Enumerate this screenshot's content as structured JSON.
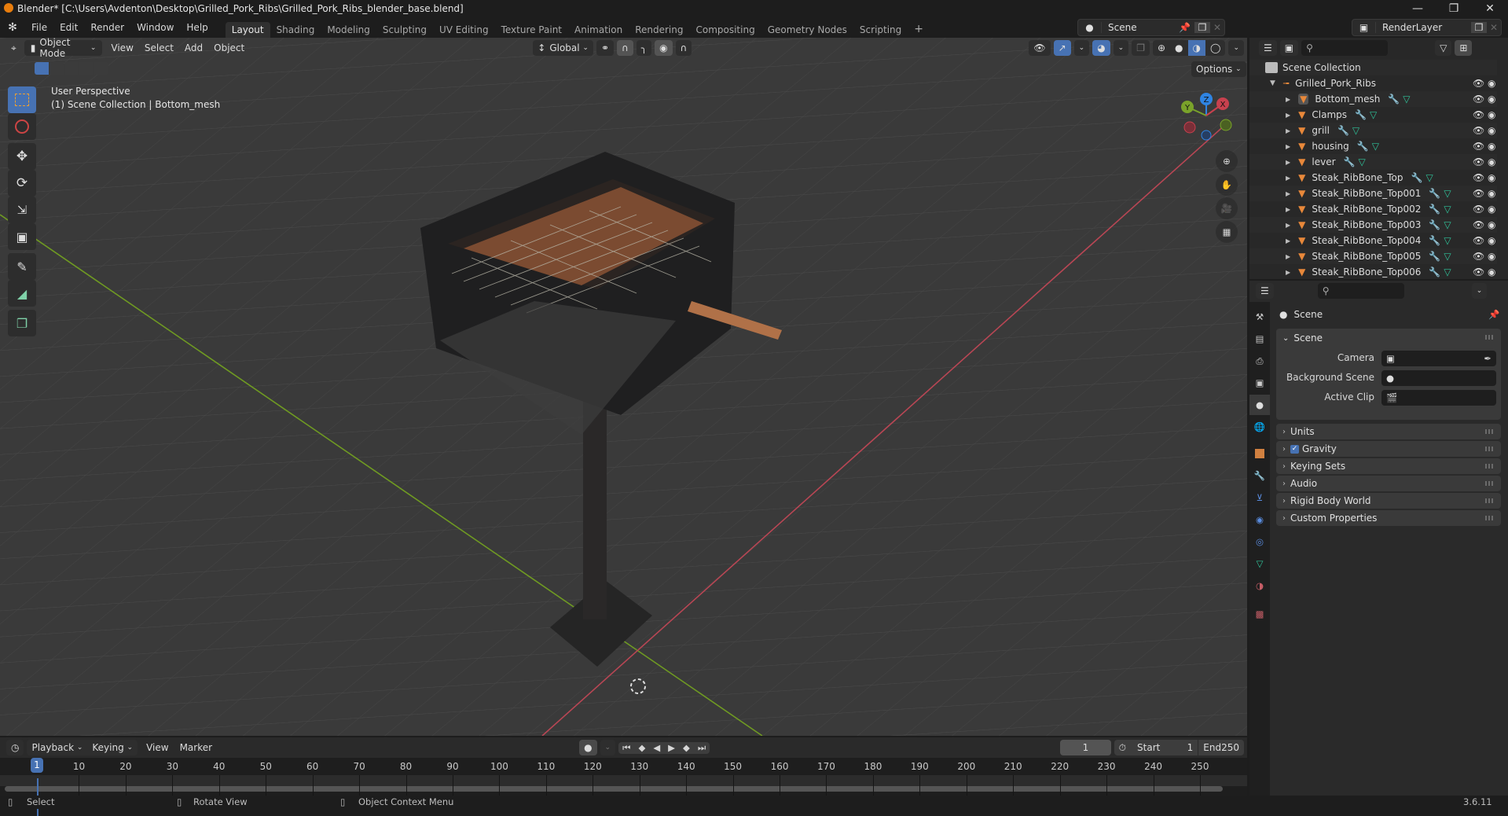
{
  "window": {
    "title": "Blender* [C:\\Users\\Avdenton\\Desktop\\Grilled_Pork_Ribs\\Grilled_Pork_Ribs_blender_base.blend]",
    "controls": [
      "minimize",
      "maximize",
      "close"
    ]
  },
  "menubar": {
    "items": [
      "File",
      "Edit",
      "Render",
      "Window",
      "Help"
    ],
    "workspaces": [
      "Layout",
      "Shading",
      "Modeling",
      "Sculpting",
      "UV Editing",
      "Texture Paint",
      "Animation",
      "Rendering",
      "Compositing",
      "Geometry Nodes",
      "Scripting"
    ],
    "active_workspace": "Layout",
    "add_workspace": "+",
    "scene": "Scene",
    "view_layer": "RenderLayer"
  },
  "viewport": {
    "mode": "Object Mode",
    "menus": [
      "View",
      "Select",
      "Add",
      "Object"
    ],
    "orientation": "Global",
    "options_label": "Options",
    "overlay_text": {
      "line1": "User Perspective",
      "line2": "(1) Scene Collection | Bottom_mesh"
    },
    "gizmo_axes": [
      "X",
      "Y",
      "Z"
    ],
    "shading_active": "material-preview",
    "colors": {
      "x_axis": "#c8414e",
      "y_axis": "#7aa32a",
      "z_axis": "#2f84e3",
      "accent": "#4772b3"
    }
  },
  "tools": [
    "select-box",
    "cursor",
    "move",
    "rotate",
    "scale",
    "transform",
    "annotate",
    "measure",
    "add-cube"
  ],
  "outliner": {
    "root": "Scene Collection",
    "collection": "Grilled_Pork_Ribs",
    "objects": [
      {
        "name": "Bottom_mesh",
        "active": true
      },
      {
        "name": "Clamps"
      },
      {
        "name": "grill"
      },
      {
        "name": "housing"
      },
      {
        "name": "lever"
      },
      {
        "name": "Steak_RibBone_Top"
      },
      {
        "name": "Steak_RibBone_Top001"
      },
      {
        "name": "Steak_RibBone_Top002"
      },
      {
        "name": "Steak_RibBone_Top003"
      },
      {
        "name": "Steak_RibBone_Top004"
      },
      {
        "name": "Steak_RibBone_Top005"
      },
      {
        "name": "Steak_RibBone_Top006"
      }
    ]
  },
  "properties": {
    "context": "Scene",
    "scene_panel": {
      "title": "Scene",
      "fields": [
        {
          "label": "Camera",
          "value": ""
        },
        {
          "label": "Background Scene",
          "value": ""
        },
        {
          "label": "Active Clip",
          "value": ""
        }
      ]
    },
    "collapsed_panels": [
      {
        "title": "Units"
      },
      {
        "title": "Gravity",
        "checkbox": true
      },
      {
        "title": "Keying Sets"
      },
      {
        "title": "Audio"
      },
      {
        "title": "Rigid Body World"
      },
      {
        "title": "Custom Properties"
      }
    ]
  },
  "timeline": {
    "menus": [
      "Playback",
      "Keying",
      "View",
      "Marker"
    ],
    "current_frame": "1",
    "start_label": "Start",
    "start": "1",
    "end_label": "End",
    "end": "250",
    "ticks": [
      "10",
      "20",
      "30",
      "40",
      "50",
      "60",
      "70",
      "80",
      "90",
      "100",
      "110",
      "120",
      "130",
      "140",
      "150",
      "160",
      "170",
      "180",
      "190",
      "200",
      "210",
      "220",
      "230",
      "240",
      "250"
    ],
    "playhead_label": "1"
  },
  "statusbar": {
    "hints": [
      "Select",
      "Rotate View",
      "Object Context Menu"
    ],
    "version": "3.6.11"
  }
}
